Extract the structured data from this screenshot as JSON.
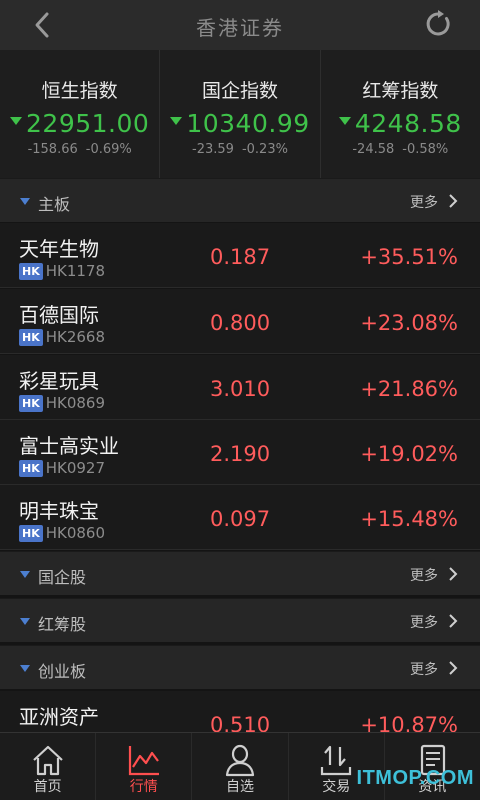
{
  "header": {
    "title": "香港证券"
  },
  "indices": [
    {
      "name": "恒生指数",
      "value": "22951.00",
      "change": "-158.66",
      "percent": "-0.69%"
    },
    {
      "name": "国企指数",
      "value": "10340.99",
      "change": "-23.59",
      "percent": "-0.23%"
    },
    {
      "name": "红筹指数",
      "value": "4248.58",
      "change": "-24.58",
      "percent": "-0.58%"
    }
  ],
  "sections": {
    "main_board": {
      "label": "主板",
      "more": "更多"
    },
    "h_shares": {
      "label": "国企股",
      "more": "更多"
    },
    "red_chips": {
      "label": "红筹股",
      "more": "更多"
    },
    "gem": {
      "label": "创业板",
      "more": "更多"
    }
  },
  "badge": "HK",
  "stocks": [
    {
      "name": "天年生物",
      "code": "HK1178",
      "price": "0.187",
      "change": "+35.51%"
    },
    {
      "name": "百德国际",
      "code": "HK2668",
      "price": "0.800",
      "change": "+23.08%"
    },
    {
      "name": "彩星玩具",
      "code": "HK0869",
      "price": "3.010",
      "change": "+21.86%"
    },
    {
      "name": "富士高实业",
      "code": "HK0927",
      "price": "2.190",
      "change": "+19.02%"
    },
    {
      "name": "明丰珠宝",
      "code": "HK0860",
      "price": "0.097",
      "change": "+15.48%"
    }
  ],
  "gem_stocks": [
    {
      "name": "亚洲资产",
      "price": "0.510",
      "change": "+10.87%"
    }
  ],
  "tabs": [
    {
      "label": "首页",
      "icon": "home-icon"
    },
    {
      "label": "行情",
      "icon": "chart-icon",
      "active": true
    },
    {
      "label": "自选",
      "icon": "person-icon"
    },
    {
      "label": "交易",
      "icon": "trade-icon"
    },
    {
      "label": "资讯",
      "icon": "news-icon"
    }
  ],
  "watermark": "ITMOP.COM",
  "colors": {
    "up": "#ff5c5c",
    "down": "#3fc24a",
    "accent": "#4c7fd0",
    "active_tab": "#ff4f4f"
  }
}
